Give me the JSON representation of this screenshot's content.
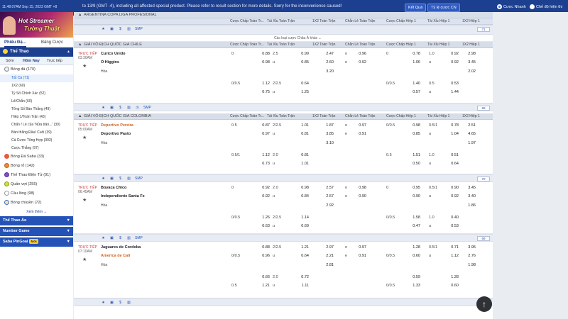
{
  "topbar": {
    "clock": "11:48:07AM Sep 15, 2023 GMT +8",
    "notice": "to 13/9 (GMT -4), including all affected special product. Please refer to result section for more details. Sorry for the inconvenience caused!",
    "btn_results": "Kết Quả",
    "btn_odds": "Tỷ lệ cược CN",
    "chk_quick": "Cược Nhanh",
    "chk_single": "Chế độ hiện thị"
  },
  "banner": {
    "line1": "Hot Streamer",
    "line2": "Tường Thuật"
  },
  "sidebar": {
    "tab1": "Phiếu Đặ...",
    "tab2": "Bảng Cược",
    "sport_header": "Thể Thao",
    "day_tabs": [
      "Sớm",
      "Hôm Nay",
      "Trực tiếp"
    ],
    "football": "Bóng đá (170)",
    "sub_items": [
      "Tất Cả (71)",
      "1X2 (60)",
      "Tỷ Số Chính Xác (52)",
      "Lẻ/Chẵn (60)",
      "Tổng Số Bàn Thắng (49)",
      "Hiệp 1/Toàn Trận (43)",
      "Chấn / Lẻ của 'Nửa trận...' (39)",
      "Bàn thắng Đầu/ Cuối (39)",
      "Cá Cược Tổng Hợp (993)",
      "Cược Thắng (97)"
    ],
    "sports": [
      "Bóng Đá Saba (33)",
      "Bóng rổ (142)",
      "Thể Thao Điện Tử (91)",
      "Quần vợt (255)",
      "Cầu lông (98)",
      "Bóng chuyền (72)"
    ],
    "more": "Xem thêm",
    "bars": [
      "Thể Thao Ảo",
      "Number Game",
      "Saba PinGoal"
    ],
    "badge_new": "Mới"
  },
  "columns": {
    "ft_hdp": "Cược Chấp Toàn Tr...",
    "ft_ou": "Tài Xỉu Toàn Trận",
    "ft_1x2": "1X2 Toàn Trận",
    "ft_oe": "Chẵn Lẻ Toàn Trận",
    "h1_hdp": "Cược Chấp Hiệp 1",
    "h1_ou": "Tài Xỉu Hiệp 1",
    "h1_1x2": "1X2 Hiệp 1"
  },
  "leagues": {
    "argentina": "ARGENTINA COPA LIGA PROFESIONAL",
    "chile": "GIẢI VÔ ĐỊCH QUỐC GIA CHILE",
    "colombia": "GIẢI VÔ ĐỊCH QUỐC GIA COLOMBIA",
    "dropdown": "Các loại cược Châu Á khác",
    "smp": "SMP"
  },
  "counts": [
    "71",
    "69",
    "70",
    "69"
  ],
  "matches": {
    "m1": {
      "live": "TRỰC TIẾP",
      "time": "03:30AM",
      "home": "Curico Unido",
      "away": "O Higgins",
      "draw": "Hòa",
      "r1": [
        "0",
        "0.88",
        "2.5",
        "0.99",
        "2.47",
        "o",
        "0.96",
        "0",
        "0.78",
        "1.0",
        "0.92",
        "2.98"
      ],
      "r2": [
        "",
        "0.98",
        "u",
        "0.85",
        "2.60",
        "e",
        "0.92",
        "",
        "1.06",
        "u",
        "0.92",
        "3.45"
      ],
      "r3": [
        "3.20",
        "2.02"
      ],
      "a1": [
        "0/0.5",
        "1.12",
        "2/2.5",
        "0.64",
        "0/0.5",
        "1.40",
        "0.5",
        "0.53"
      ],
      "a2": [
        "",
        "0.75",
        "u",
        "1.25",
        "",
        "0.57",
        "u",
        "1.44"
      ]
    },
    "m2": {
      "live": "TRỰC TIẾP",
      "time": "05:00AM",
      "home": "Deportivo Pereira",
      "away": "Deportivo Pasto",
      "draw": "Hòa",
      "r1": [
        "0.5",
        "0.87",
        "2/2.5",
        "1.01",
        "1.87",
        "o",
        "0.97",
        "0/0.5",
        "0.98",
        "0.5/1",
        "0.78",
        "2.51"
      ],
      "r2": [
        "",
        "0.97",
        "u",
        "0.81",
        "3.85",
        "e",
        "0.91",
        "",
        "0.85",
        "u",
        "1.04",
        "4.65"
      ],
      "r3": [
        "3.10",
        "1.97"
      ],
      "a1": [
        "0.5/1",
        "1.12",
        "2.0",
        "0.81",
        "0.5",
        "1.51",
        "1.0",
        "0.51"
      ],
      "a2": [
        "",
        "0.73",
        "u",
        "1.01",
        "",
        "0.50",
        "u",
        "0.64"
      ]
    },
    "m3": {
      "live": "TRỰC TIẾP",
      "time": "06:45AM",
      "home": "Boyaca Chico",
      "away": "Independiente Santa Fe",
      "draw": "Hòa",
      "r1": [
        "0",
        "0.92",
        "2.0",
        "0.98",
        "2.57",
        "o",
        "0.98",
        "0",
        "0.95",
        "0.5/1",
        "0.90",
        "3.45"
      ],
      "r2": [
        "",
        "0.92",
        "u",
        "0.84",
        "2.57",
        "e",
        "0.90",
        "",
        "0.90",
        "u",
        "0.92",
        "3.40"
      ],
      "r3": [
        "2.92",
        "1.86"
      ],
      "a1": [
        "0/0.5",
        "1.26",
        "2/2.5",
        "1.14",
        "0/0.5",
        "1.58",
        "1.0",
        "0.40"
      ],
      "a2": [
        "",
        "0.63",
        "u",
        "0.69",
        "",
        "0.47",
        "u",
        "0.53"
      ]
    },
    "m4": {
      "live": "TRỰC TIẾP",
      "time": "07:10AM",
      "home": "Jaguares de Cordoba",
      "away": "America de Cali",
      "draw": "Hòa",
      "r1": [
        "",
        "0.88",
        "2/2.5",
        "1.21",
        "2.97",
        "o",
        "0.97",
        "",
        "1.28",
        "0.5/1",
        "0.71",
        "3.95"
      ],
      "r2": [
        "0/0.5",
        "0.96",
        "u",
        "0.64",
        "2.21",
        "e",
        "0.91",
        "0/0.5",
        "0.60",
        "u",
        "1.12",
        "2.76"
      ],
      "r3": [
        "2.81",
        "1.98"
      ],
      "a1": [
        "",
        "0.66",
        "2.0",
        "0.72",
        "",
        "0.59",
        "",
        "1.28"
      ],
      "a2": [
        "0.5",
        "1.21",
        "u",
        "1.11",
        "0/0.5",
        "1.33",
        "",
        "0.60"
      ]
    }
  }
}
